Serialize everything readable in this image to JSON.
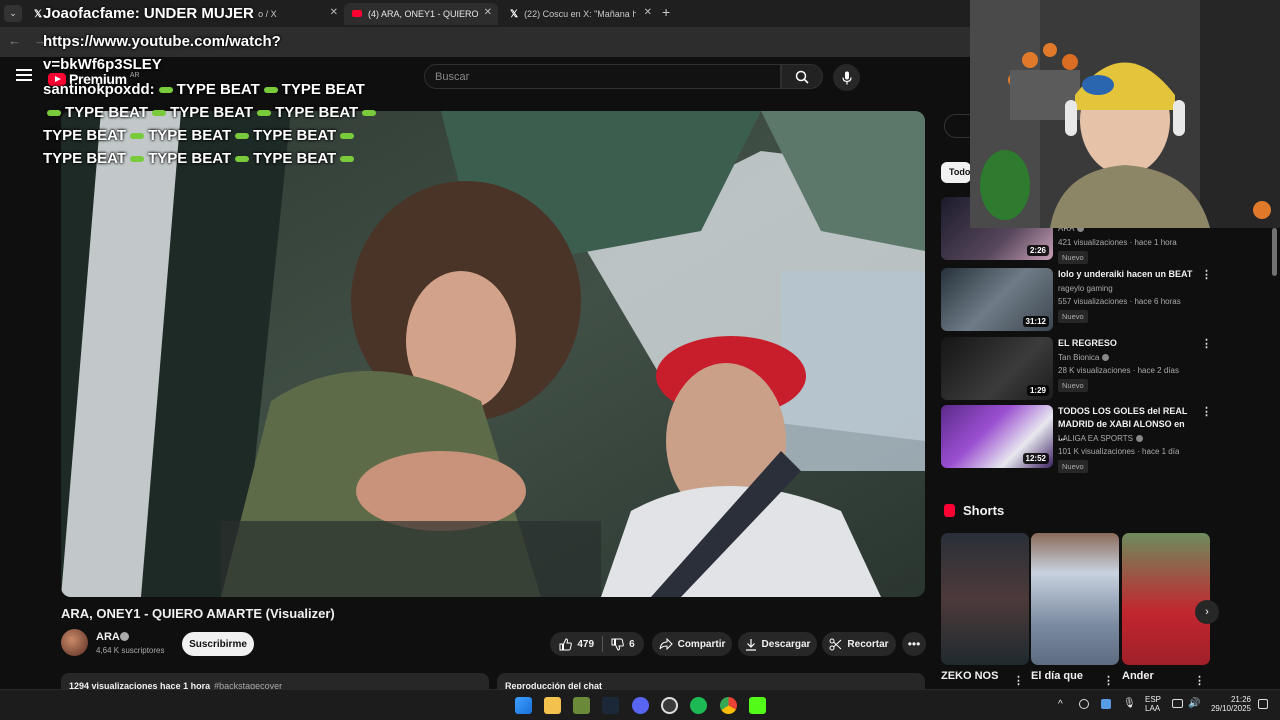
{
  "browser": {
    "tabs": [
      {
        "label": "Joaofacfame: UNDER MUJER",
        "favicon": "x-icon"
      },
      {
        "label": "(4) ARA, ONEY1 - QUIERO AMARTE",
        "favicon": "youtube-icon"
      },
      {
        "label": "(22) Coscu en X: \"Mañana hago",
        "favicon": "x-icon"
      }
    ],
    "tab_partial": "o / X",
    "url": "https://www.youtube.com/watch?v=bkWf6p3SLEY"
  },
  "overlay": {
    "donor_line": "Joaofacfame: UNDER MUJER",
    "url_line1": "https://www.youtube.com/watch?",
    "url_line2": "v=bkWf6p3SLEY",
    "chat_user": "santinokpoxdd:",
    "chat_phrase": "TYPE BEAT"
  },
  "youtube": {
    "logo_text": "Premium",
    "logo_region": "AR",
    "search_placeholder": "Buscar",
    "video_title": "ARA, ONEY1 - QUIERO AMARTE (Visualizer)",
    "channel": "ARA",
    "subscribers": "4,64 K suscriptores",
    "subscribe_label": "Suscribirme",
    "likes": "479",
    "dislikes": "6",
    "share_label": "Compartir",
    "download_label": "Descargar",
    "clip_label": "Recortar",
    "description": "1294 visualizaciones hace 1 hora",
    "description_tag": "#backstagecover",
    "chat_replay_label": "Reproducción del chat"
  },
  "sidebar": {
    "chip": "Todo",
    "recommendations": [
      {
        "title": "",
        "channel": "ARA",
        "verified": true,
        "meta": "421 visualizaciones · hace 1 hora",
        "badge": "Nuevo",
        "duration": "2:26"
      },
      {
        "title": "lolo y underaiki hacen un BEAT",
        "channel": "rageylo gaming",
        "verified": false,
        "meta": "557 visualizaciones · hace 6 horas",
        "badge": "Nuevo",
        "duration": "31:12"
      },
      {
        "title": "EL REGRESO",
        "channel": "Tan Bionica",
        "verified": true,
        "meta": "28 K visualizaciones · hace 2 días",
        "badge": "Nuevo",
        "duration": "1:29"
      },
      {
        "title": "TODOS LOS GOLES del REAL MADRID de XABI ALONSO en ...",
        "channel": "LALIGA EA SPORTS",
        "verified": true,
        "meta": "101 K visualizaciones · hace 1 día",
        "badge": "Nuevo",
        "duration": "12:52"
      }
    ],
    "shorts_title": "Shorts",
    "shorts": [
      {
        "title": "ZEKO NOS"
      },
      {
        "title": "El día que"
      },
      {
        "title": "Ander"
      }
    ]
  },
  "taskbar": {
    "lang": "ESP",
    "lang2": "LAA",
    "time": "21:26",
    "date": "29/10/2025"
  },
  "colors": {
    "yt_red": "#ff0033",
    "background": "#0f0f0f",
    "emote_green": "#7acb3c"
  }
}
